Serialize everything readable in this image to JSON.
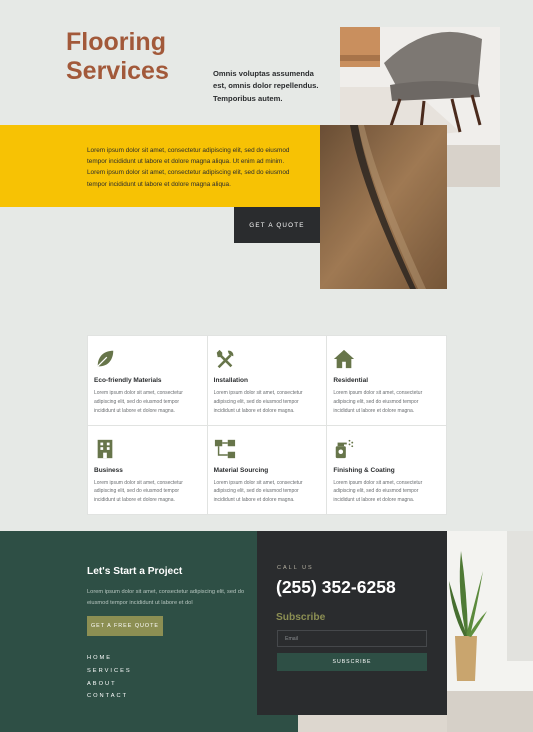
{
  "hero": {
    "title_line1": "Flooring",
    "title_line2": "Services",
    "intro": "Omnis voluptas assumenda est, omnis dolor repellendus. Temporibus autem.",
    "band_text": "Lorem ipsum dolor sit amet, consectetur adipiscing elit, sed do eiusmod tempor incididunt ut labore et dolore magna aliqua. Ut enim ad minim. Lorem ipsum dolor sit amet, consectetur adipiscing elit, sed do eiusmod tempor incididunt ut labore et dolore magna aliqua.",
    "quote_button": "GET A QUOTE"
  },
  "services": [
    {
      "title": "Eco-friendly Materials",
      "desc": "Lorem ipsum dolor sit amet, consectetur adipiscing elit, sed do eiusmod tempor incididunt ut labore et dolore magna.",
      "icon": "leaf-icon"
    },
    {
      "title": "Installation",
      "desc": "Lorem ipsum dolor sit amet, consectetur adipiscing elit, sed do eiusmod tempor incididunt ut labore et dolore magna.",
      "icon": "tools-icon"
    },
    {
      "title": "Residential",
      "desc": "Lorem ipsum dolor sit amet, consectetur adipiscing elit, sed do eiusmod tempor incididunt ut labore et dolore magna.",
      "icon": "house-icon"
    },
    {
      "title": "Business",
      "desc": "Lorem ipsum dolor sit amet, consectetur adipiscing elit, sed do eiusmod tempor incididunt ut labore et dolore magna.",
      "icon": "building-icon"
    },
    {
      "title": "Material Sourcing",
      "desc": "Lorem ipsum dolor sit amet, consectetur adipiscing elit, sed do eiusmod tempor incididunt ut labore et dolore magna.",
      "icon": "flowchart-icon"
    },
    {
      "title": "Finishing & Coating",
      "desc": "Lorem ipsum dolor sit amet, consectetur adipiscing elit, sed do eiusmod tempor incididunt ut labore et dolore magna.",
      "icon": "spray-bottle-icon"
    }
  ],
  "footer": {
    "title": "Let's Start a Project",
    "text": "Lorem ipsum dolor sit amet, consectetur adipiscing elit, sed do eiusmod tempor incididunt ut labore et dol",
    "free_quote_button": "GET A FREE QUOTE",
    "nav": [
      "HOME",
      "SERVICES",
      "ABOUT",
      "CONTACT"
    ],
    "call_us_label": "CALL US",
    "phone": "(255) 352-6258",
    "subscribe_title": "Subscribe",
    "email_placeholder": "Email",
    "subscribe_button": "SUBSCRIBE"
  },
  "colors": {
    "brand_brown": "#a2593a",
    "accent_yellow": "#f7c204",
    "dark": "#2a2c2e",
    "forest_green": "#2e4f45",
    "olive": "#8c8f53",
    "icon_green": "#67754a"
  }
}
